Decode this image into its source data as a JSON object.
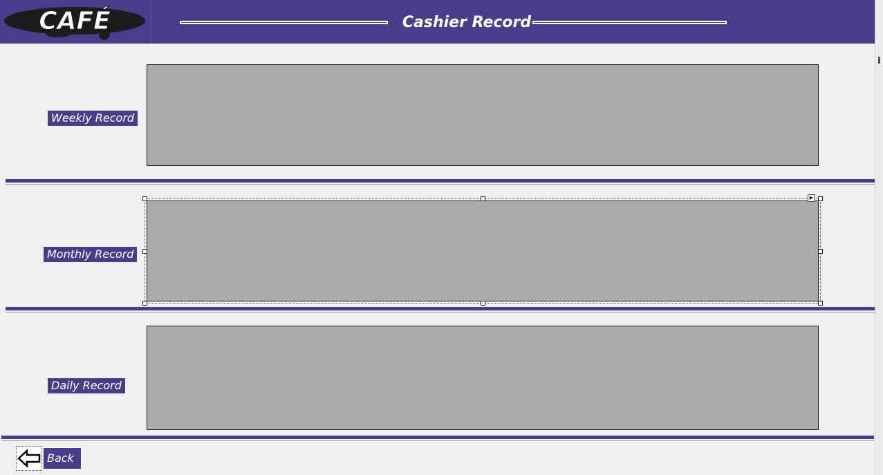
{
  "header": {
    "logo_text": "CAFÉ",
    "title": "Cashier Record"
  },
  "sections": {
    "weekly": {
      "label": "Weekly Record"
    },
    "monthly": {
      "label": "Monthly Record"
    },
    "daily": {
      "label": "Daily Record"
    }
  },
  "footer": {
    "back_label": "Back"
  },
  "colors": {
    "brand": "#483d8b",
    "grid_bg": "#ababab",
    "page_bg": "#f0f0f0"
  },
  "icons": {
    "logo": "cafe-logo",
    "back": "left-arrow-icon",
    "smart_tag": "smart-tag-arrow-icon"
  }
}
